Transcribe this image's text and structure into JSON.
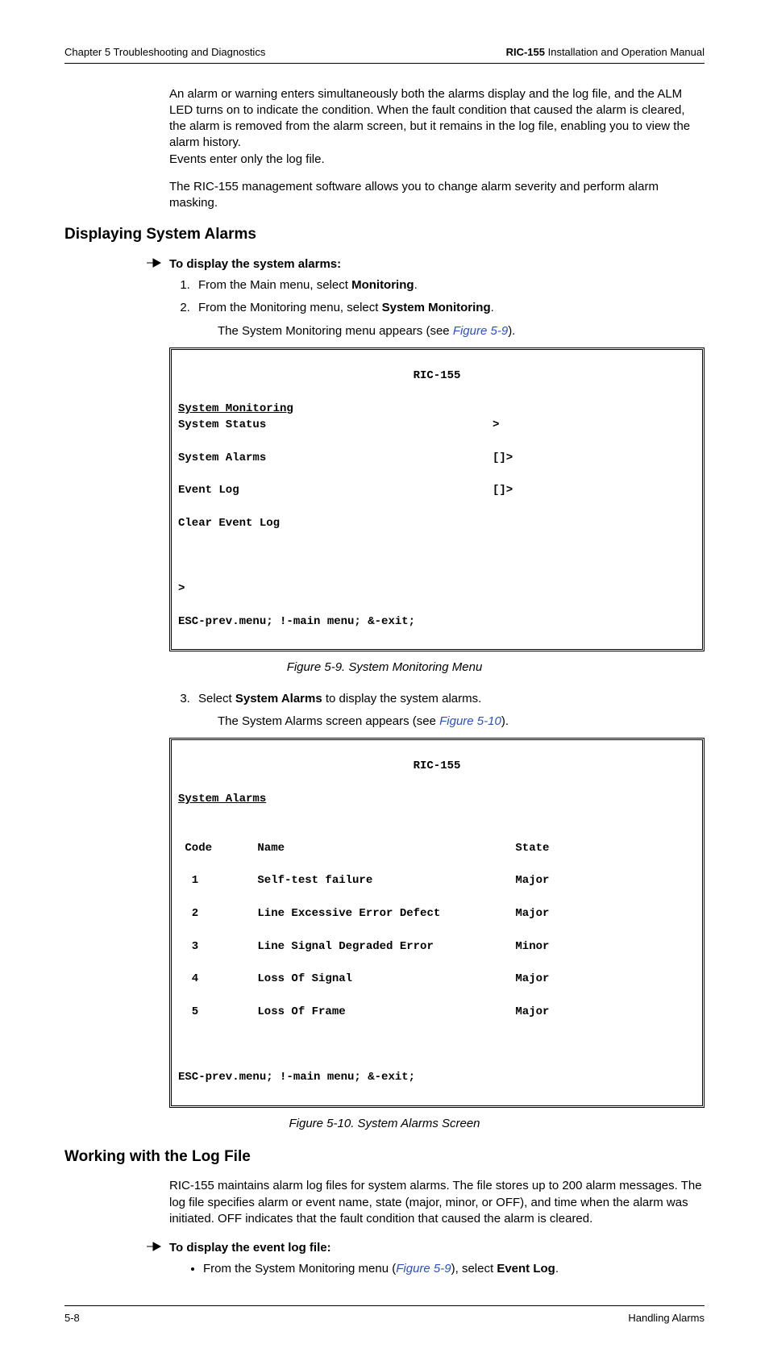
{
  "header": {
    "left": "Chapter 5  Troubleshooting and Diagnostics",
    "right_bold": "RIC-155",
    "right_rest": " Installation and Operation Manual"
  },
  "intro_para1": "An alarm or warning enters simultaneously both the alarms display and the log file, and the ALM LED turns on to indicate the condition. When the fault condition that caused the alarm is cleared, the alarm is removed from the alarm screen, but it remains in the log file, enabling you to view the alarm history.",
  "intro_para1b": "Events enter only the log file.",
  "intro_para2": "The RIC-155 management software allows you to change alarm severity and perform alarm masking.",
  "section1": {
    "title": "Displaying System Alarms",
    "proc_head": "To display the system alarms:",
    "step1_pre": "From the Main menu, select ",
    "step1_bold": "Monitoring",
    "step1_post": ".",
    "step2_pre": "From the Monitoring menu, select ",
    "step2_bold": "System Monitoring",
    "step2_post": ".",
    "step2_sub_pre": "The System Monitoring menu appears (see ",
    "step2_sub_link": "Figure 5-9",
    "step2_sub_post": ").",
    "fig1_caption": "Figure 5-9.  System Monitoring Menu",
    "step3_pre": "Select ",
    "step3_bold": "System Alarms",
    "step3_post": " to display the system alarms.",
    "step3_sub_pre": "The System Alarms screen appears (see ",
    "step3_sub_link": "Figure 5-10",
    "step3_sub_post": ").",
    "fig2_caption": "Figure 5-10.  System Alarms Screen"
  },
  "term1": {
    "title": "RIC-155",
    "subtitle": "System Monitoring",
    "rows": [
      {
        "label": "System Status",
        "mark": ">"
      },
      {
        "label": "System Alarms",
        "mark": "[]>"
      },
      {
        "label": "Event Log",
        "mark": "[]>"
      },
      {
        "label": "Clear Event Log",
        "mark": ""
      }
    ],
    "prompt": ">",
    "footer": "ESC-prev.menu; !-main menu; &-exit;"
  },
  "term2": {
    "title": "RIC-155",
    "subtitle": "System Alarms",
    "head": {
      "c1": "Code",
      "c2": "Name",
      "c3": "State"
    },
    "rows": [
      {
        "c1": " 1",
        "c2": "Self-test failure",
        "c3": "Major"
      },
      {
        "c1": " 2",
        "c2": "Line Excessive Error Defect",
        "c3": "Major"
      },
      {
        "c1": " 3",
        "c2": "Line Signal Degraded Error",
        "c3": "Minor"
      },
      {
        "c1": " 4",
        "c2": "Loss Of Signal",
        "c3": "Major"
      },
      {
        "c1": " 5",
        "c2": "Loss Of Frame",
        "c3": "Major"
      }
    ],
    "footer": "ESC-prev.menu; !-main menu; &-exit;"
  },
  "section2": {
    "title": "Working with the Log File",
    "para": "RIC-155 maintains alarm log files for system alarms. The file stores up to 200 alarm messages. The log file specifies alarm or event name, state (major, minor, or OFF), and time when the alarm was initiated. OFF indicates that the fault condition that caused the alarm is cleared.",
    "proc_head": "To display the event log file:",
    "bullet_pre": "From the System Monitoring menu (",
    "bullet_link": "Figure 5-9",
    "bullet_mid": "), select ",
    "bullet_bold": "Event Log",
    "bullet_post": "."
  },
  "footer": {
    "left": "5-8",
    "right": "Handling Alarms"
  }
}
